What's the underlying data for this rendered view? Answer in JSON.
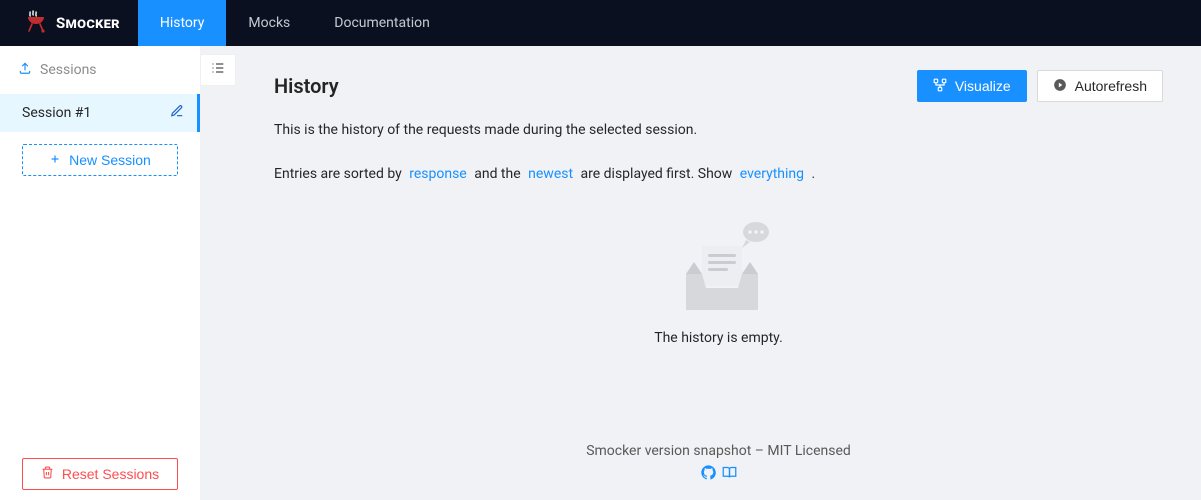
{
  "brand": "Smocker",
  "nav": {
    "history": "History",
    "mocks": "Mocks",
    "documentation": "Documentation"
  },
  "sidebar": {
    "title": "Sessions",
    "items": [
      {
        "label": "Session #1"
      }
    ],
    "new_session_label": "New Session",
    "reset_label": "Reset Sessions"
  },
  "page": {
    "title": "History",
    "description": "This is the history of the requests made during the selected session.",
    "sort_prefix": "Entries are sorted by",
    "sort_value": "response",
    "sort_middle": "and the",
    "order_value": "newest",
    "sort_suffix": "are displayed first. Show",
    "filter_value": "everything",
    "sort_end": ".",
    "empty_text": "The history is empty."
  },
  "actions": {
    "visualize": "Visualize",
    "autorefresh": "Autorefresh"
  },
  "footer": {
    "text": "Smocker version snapshot – MIT Licensed"
  }
}
